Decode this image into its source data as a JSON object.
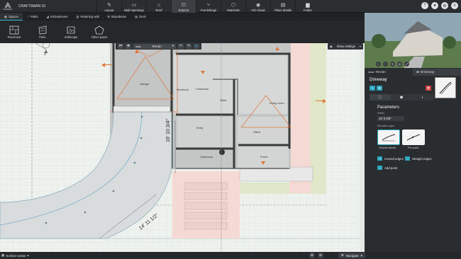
{
  "app": {
    "logo_text": "CEDREO",
    "project_name": "CRAFTSMAN 10"
  },
  "main_tabs": [
    {
      "icon": "layout-icon",
      "glyph": "✎",
      "label": "Layout"
    },
    {
      "icon": "wall-openings-icon",
      "glyph": "▭",
      "label": "Wall Openings"
    },
    {
      "icon": "roof-icon",
      "glyph": "⌂",
      "label": "Roof"
    },
    {
      "icon": "exterior-icon",
      "glyph": "⛫",
      "label": "Exterior"
    },
    {
      "icon": "furnishings-icon",
      "glyph": "⑂",
      "label": "Furnishings"
    },
    {
      "icon": "materials-icon",
      "glyph": "⬡",
      "label": "Materials"
    },
    {
      "icon": "hd-visual-icon",
      "glyph": "◉",
      "label": "HD Visual"
    },
    {
      "icon": "plans-details-icon",
      "glyph": "▤",
      "label": "Plans details"
    },
    {
      "icon": "folder-icon",
      "glyph": "▆",
      "label": "Folder"
    }
  ],
  "active_main_tab": "Exterior",
  "sub_tabs": [
    "Spaces",
    "Paths",
    "Embankment",
    "Retaining wall",
    "Boundaries",
    "Deck"
  ],
  "ribbon": [
    "Pavement",
    "Patio",
    "Softscape",
    "Other space"
  ],
  "canvas_toolbar": {
    "level": "Terrain"
  },
  "show_settings": "Show settings",
  "plan_labels": {
    "garage": "Garage",
    "clearance1": "Clearance",
    "toilet": "Toilet",
    "living": "Living room",
    "mudroom": "Mudroom",
    "entry": "Entry",
    "office": "Office",
    "clearance2": "Clearance",
    "porch": "Porch",
    "dim1": "16' 10 3/4\"",
    "dim2": "14' 11 1/2\"",
    "num5": "5"
  },
  "right_panel": {
    "crumb_terrain": "Terrain",
    "crumb_driveway": "Driveway",
    "object_title": "Driveway",
    "parameters": "Parameters",
    "width_label": "Width",
    "width_value": "19' 8 5/8\"",
    "elevation_label": "Elevation type",
    "elev_ground": "Ground terrain",
    "elev_per_point": "Per point",
    "curved_edges": "Curved edges",
    "straight_edges": "Straight edges",
    "add_point": "Add point"
  },
  "bottom": {
    "surface_areas": "Surface areas",
    "navigate": "Navigate"
  }
}
